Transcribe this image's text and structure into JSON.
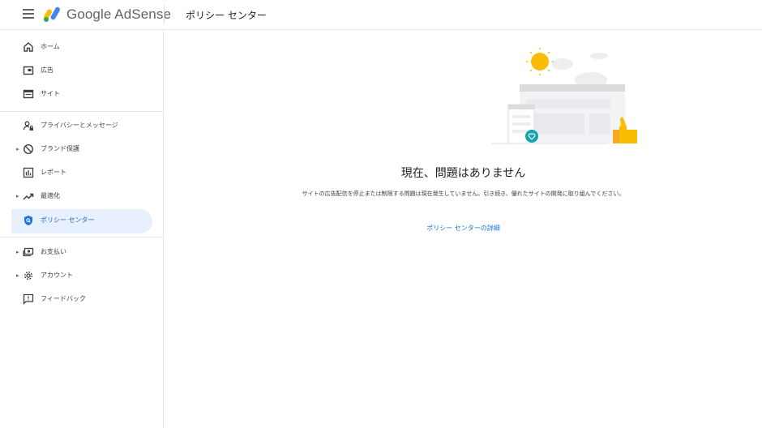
{
  "header": {
    "brand": "Google AdSense",
    "page_title": "ポリシー センター"
  },
  "sidebar": {
    "items": [
      {
        "label": "ホーム",
        "icon": "home-icon"
      },
      {
        "label": "広告",
        "icon": "ad-unit-icon"
      },
      {
        "label": "サイト",
        "icon": "web-icon"
      },
      {
        "label": "プライバシーとメッセージ",
        "icon": "person-lock-icon"
      },
      {
        "label": "ブランド保護",
        "icon": "block-icon"
      },
      {
        "label": "レポート",
        "icon": "bar-chart-icon"
      },
      {
        "label": "最適化",
        "icon": "trending-up-icon"
      },
      {
        "label": "ポリシー センター",
        "icon": "policy-shield-icon"
      },
      {
        "label": "お支払い",
        "icon": "payments-icon"
      },
      {
        "label": "アカウント",
        "icon": "gear-icon"
      },
      {
        "label": "フィードバック",
        "icon": "feedback-icon"
      }
    ]
  },
  "main": {
    "title": "現在、問題はありません",
    "description": "サイトの広告配信を停止または制限する問題は現在発生していません。引き続き、優れたサイトの開発に取り組んでください。",
    "link": "ポリシー センターの詳細"
  },
  "colors": {
    "accent": "#1a73e8",
    "active_bg": "#e8f0fe",
    "sun": "#fbbc04",
    "teal": "#12a4af"
  }
}
